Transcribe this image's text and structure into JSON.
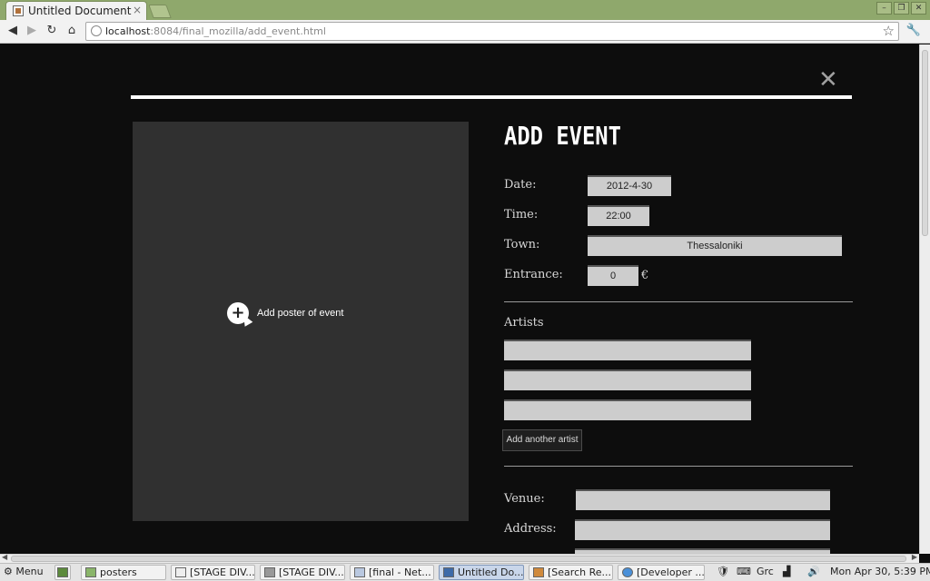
{
  "browser": {
    "tab_title": "Untitled Document",
    "tab_close": "×",
    "url_host": "localhost",
    "url_rest": ":8084/final_mozilla/add_event.html"
  },
  "page": {
    "close_symbol": "✕",
    "poster_label": "Add poster of event",
    "heading": "ADD EVENT",
    "fields": {
      "date_label": "Date:",
      "date_value": "2012-4-30",
      "time_label": "Time:",
      "time_value": "22:00",
      "town_label": "Town:",
      "town_value": "Thessaloniki",
      "entrance_label": "Entrance:",
      "entrance_value": "0",
      "currency": "€",
      "venue_label": "Venue:",
      "address_label": "Address:"
    },
    "artists_label": "Artists",
    "artist_values": [
      "",
      "",
      ""
    ],
    "add_artist_button": "Add another artist"
  },
  "taskbar": {
    "menu": "Menu",
    "items": [
      {
        "label": "posters",
        "active": false
      },
      {
        "label": "[STAGE DIV...",
        "active": false
      },
      {
        "label": "[STAGE DIV...",
        "active": false
      },
      {
        "label": "[final - Net...",
        "active": false
      },
      {
        "label": "Untitled Do...",
        "active": true
      },
      {
        "label": "[Search Re...",
        "active": false
      },
      {
        "label": "[Developer ...",
        "active": false
      }
    ],
    "keyboard_layout": "Grc",
    "clock": "Mon Apr 30,  5:39 PM"
  },
  "icons": {
    "back": "back-arrow-icon",
    "forward": "forward-arrow-icon",
    "reload": "reload-icon",
    "home": "home-icon",
    "bookmark": "star-icon",
    "settings": "wrench-icon"
  }
}
